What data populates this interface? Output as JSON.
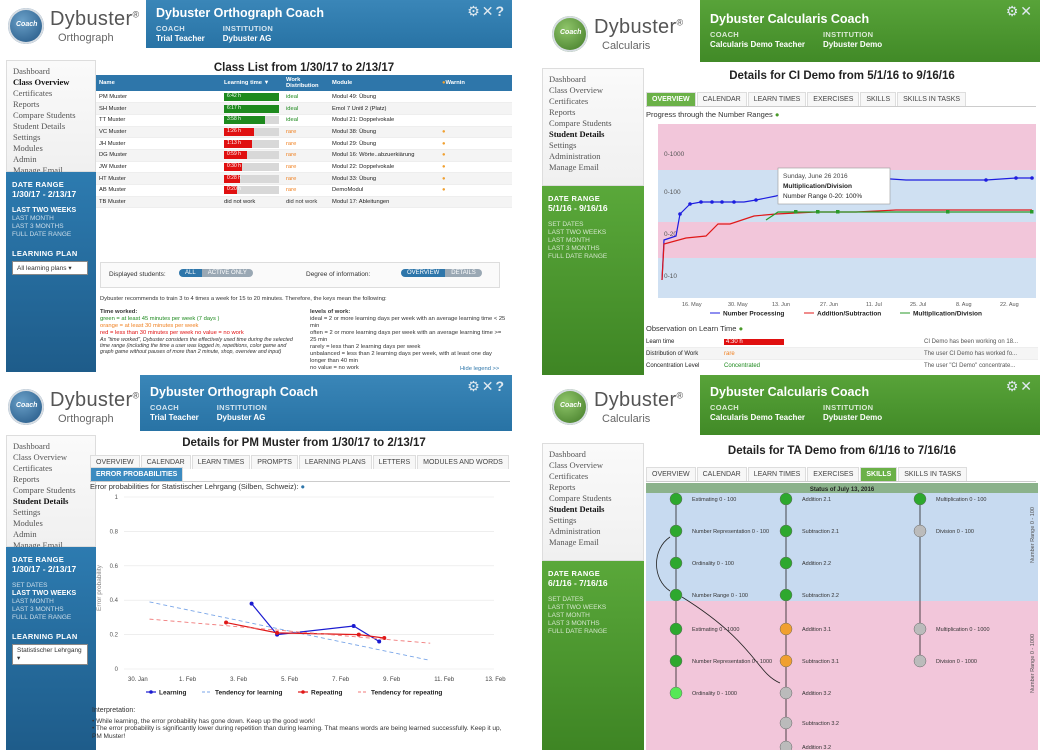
{
  "orthograph_classlist": {
    "logo": {
      "main": "Dybuster",
      "sub": "Orthograph",
      "badge": "Coach"
    },
    "band": {
      "title": "Dybuster Orthograph Coach",
      "coach_label": "COACH",
      "coach": "Trial Teacher",
      "inst_label": "INSTITUTION",
      "inst": "Dybuster AG",
      "icons": "⚙✕?"
    },
    "nav": [
      "Dashboard",
      "Class Overview",
      "Certificates",
      "Reports",
      "Compare Students",
      "Student Details",
      "Settings",
      "Modules",
      "Admin",
      "Manage Email"
    ],
    "date_range": {
      "heading": "DATE RANGE",
      "dates": "1/30/17 - 2/13/17",
      "links": [
        "LAST TWO WEEKS",
        "LAST MONTH",
        "LAST 3 MONTHS",
        "FULL DATE RANGE"
      ]
    },
    "learning_plan": {
      "heading": "LEARNING PLAN",
      "value": "All learning plans"
    },
    "title": "Class List from 1/30/17 to 2/13/17",
    "columns": [
      "Name",
      "Learning time",
      "Work Distribution",
      "Module",
      "Warnin"
    ],
    "rows": [
      {
        "name": "PM Muster",
        "time": "6:42 h",
        "pct": 1.0,
        "color": "#1e8a1e",
        "dist": "ideal",
        "module": "Modul 49: Übung",
        "warn": false
      },
      {
        "name": "SH Muster",
        "time": "6:17 h",
        "pct": 1.0,
        "color": "#1e8a1e",
        "dist": "ideal",
        "module": "Emol 7 Unitl 2 (Platz)",
        "warn": false
      },
      {
        "name": "TT Muster",
        "time": "3:58 h",
        "pct": 0.74,
        "color": "#1e8a1e",
        "dist": "ideal",
        "module": "Modul 21: Doppelvokale",
        "warn": false
      },
      {
        "name": "VC Muster",
        "time": "1:26 h",
        "pct": 0.55,
        "color": "#e01010",
        "dist": "rare",
        "module": "Modul 38: Übung",
        "warn": true
      },
      {
        "name": "JH Muster",
        "time": "1:13 h",
        "pct": 0.5,
        "color": "#e01010",
        "dist": "rare",
        "module": "Modul 29: Übung",
        "warn": true
      },
      {
        "name": "DG Muster",
        "time": "0:59 h",
        "pct": 0.42,
        "color": "#e01010",
        "dist": "rare",
        "module": "Modul 16: Wörte..abzuerkiärung",
        "warn": true
      },
      {
        "name": "JW Muster",
        "time": "0:30 h",
        "pct": 0.33,
        "color": "#e01010",
        "dist": "rare",
        "module": "Modul 22: Doppelvokale",
        "warn": true
      },
      {
        "name": "HT Muster",
        "time": "0:28 h",
        "pct": 0.29,
        "color": "#e01010",
        "dist": "rare",
        "module": "Modul 33: Übung",
        "warn": true
      },
      {
        "name": "AB Muster",
        "time": "0:20 h",
        "pct": 0.24,
        "color": "#e01010",
        "dist": "rare",
        "module": "DemoModul",
        "warn": true
      },
      {
        "name": "TB Muster",
        "time": "did not work",
        "pct": 0,
        "color": "#e01010",
        "dist": "did not work",
        "module": "Modul 17: Ableitungen",
        "warn": false
      }
    ],
    "displayed_label": "Displayed students:",
    "displayed_opts": [
      "ALL",
      "ACTIVE ONLY"
    ],
    "degree_label": "Degree of information:",
    "degree_opts": [
      "OVERVIEW",
      "DETAILS"
    ],
    "recommend": "Dybuster recommends to train 3 to 4 times a week for 15 to 20 minutes. Therefore, the keys mean the following:",
    "legend_time_h": "Time worked:",
    "legend_time": [
      "green = at least 45 minutes per week (7 days )",
      "orange = at least 30 minutes per week",
      "red = less than 30 minutes per week no value = no work",
      "As \"time worked\", Dybuster considers the effectively used time during the selected time range (including the time a user was logged in, repetitions, color game and graph game without pauses of more than 2 minute, shop, overview and input)"
    ],
    "legend_levels_h": "levels of work:",
    "legend_levels": [
      "ideal = 2 or more learning days per week with an average learning time < 25 min",
      "often = 2 or more learning days per week with an average learning time >= 25 min",
      "rarely = less than 2 learning days per week",
      "unbalanced = less than 2 learning days per week, with at least one day longer than 40 min",
      "no value = no work"
    ],
    "hide_legend": "Hide legend >>"
  },
  "calcularis_ci": {
    "logo": {
      "main": "Dybuster",
      "sub": "Calcularis",
      "badge": "Coach"
    },
    "band": {
      "title": "Dybuster Calcularis Coach",
      "coach_label": "COACH",
      "coach": "Calcularis Demo Teacher",
      "inst_label": "INSTITUTION",
      "inst": "Dybuster Demo",
      "icons": "⚙✕"
    },
    "nav": [
      "Dashboard",
      "Class Overview",
      "Certificates",
      "Reports",
      "Compare Students",
      "Student Details",
      "Settings",
      "Administration",
      "Manage Email"
    ],
    "date_range": {
      "heading": "DATE RANGE",
      "dates": "5/1/16 - 9/16/16",
      "links": [
        "SET DATES",
        "LAST TWO WEEKS",
        "LAST MONTH",
        "LAST 3 MONTHS",
        "FULL DATE RANGE"
      ]
    },
    "title": "Details for CI Demo from 5/1/16 to 9/16/16",
    "tabs": [
      "OVERVIEW",
      "CALENDAR",
      "LEARN TIMES",
      "EXERCISES",
      "SKILLS",
      "SKILLS IN TASKS"
    ],
    "progress_label": "Progress through the Number Ranges",
    "tooltip": {
      "date": "Sunday, June 26 2016",
      "series": "Multiplication/Division",
      "value": "Number Range 0-20: 100%"
    },
    "obs_label": "Observation on Learn Time",
    "obs": [
      {
        "label": "Learn time",
        "value": "4:30 h",
        "note": "CI Demo has been working on 18..."
      },
      {
        "label": "Distribution of Work",
        "value": "rare",
        "note": "The user CI Demo has worked fo..."
      },
      {
        "label": "Concentration Level",
        "value": "Concentrated",
        "note": "The user \"CI Demo\" concentrate..."
      }
    ],
    "chart_data": {
      "type": "line",
      "x": [
        "16. May",
        "30. May",
        "13. Jun",
        "27. Jun",
        "11. Jul",
        "25. Jul",
        "8. Aug",
        "22. Aug"
      ],
      "bands": [
        "0-1000",
        "0-100",
        "0-20",
        "0-10"
      ],
      "series": [
        {
          "name": "Number Processing",
          "color": "#1d1de0"
        },
        {
          "name": "Addition/Subtraction",
          "color": "#e01818"
        },
        {
          "name": "Multiplication/Division",
          "color": "#2a9a2a"
        }
      ]
    }
  },
  "orthograph_pm": {
    "logo": {
      "main": "Dybuster",
      "sub": "Orthograph",
      "badge": "Coach"
    },
    "band": {
      "title": "Dybuster Orthograph Coach",
      "coach_label": "COACH",
      "coach": "Trial Teacher",
      "inst_label": "INSTITUTION",
      "inst": "Dybuster AG",
      "icons": "⚙✕?"
    },
    "nav": [
      "Dashboard",
      "Class Overview",
      "Certificates",
      "Reports",
      "Compare Students",
      "Student Details",
      "Settings",
      "Modules",
      "Admin",
      "Manage Email"
    ],
    "date_range": {
      "heading": "DATE RANGE",
      "dates": "1/30/17 - 2/13/17",
      "links": [
        "SET DATES",
        "LAST TWO WEEKS",
        "LAST MONTH",
        "LAST 3 MONTHS",
        "FULL DATE RANGE"
      ]
    },
    "learning_plan": {
      "heading": "LEARNING PLAN",
      "value": "Statistischer Lehrgang"
    },
    "title": "Details for PM Muster from 1/30/17 to 2/13/17",
    "tabs": [
      "OVERVIEW",
      "CALENDAR",
      "LEARN TIMES",
      "PROMPTS",
      "LEARNING PLANS",
      "LETTERS",
      "MODULES AND WORDS"
    ],
    "subtab": "ERROR PROBABILITIES",
    "chart_title": "Error probabilities for Statistischer Lehrgang (Silben, Schweiz):",
    "interp_h": "Interpretation:",
    "interp": [
      "While learning, the error probability has gone down. Keep up the good work!",
      "The error probability is significantly lower during repetition than during learning. That means words are being learned successfully. Keep it up, PM Muster!"
    ],
    "chart_data": {
      "type": "line",
      "xlabels": [
        "30. Jan",
        "1. Feb",
        "3. Feb",
        "5. Feb",
        "7. Feb",
        "9. Feb",
        "11. Feb",
        "13. Feb"
      ],
      "ylabel": "Error probability",
      "ylim": [
        0,
        1
      ],
      "yticks": [
        "0",
        "0.2",
        "0.4",
        "0.6",
        "0.8",
        "1"
      ],
      "series": [
        {
          "name": "Learning",
          "color": "#1a1ad0",
          "points": [
            [
              5,
              0.38
            ],
            [
              6,
              0.2
            ],
            [
              9,
              0.25
            ],
            [
              10,
              0.16
            ]
          ]
        },
        {
          "name": "Tendency for learning",
          "color": "#7aa6e8",
          "points": [
            [
              1,
              0.39
            ],
            [
              12,
              0.05
            ]
          ]
        },
        {
          "name": "Repeating",
          "color": "#e01818",
          "points": [
            [
              4,
              0.27
            ],
            [
              6,
              0.21
            ],
            [
              9.2,
              0.2
            ],
            [
              10.2,
              0.18
            ]
          ]
        },
        {
          "name": "Tendency for repeating",
          "color": "#f07a7a",
          "points": [
            [
              1,
              0.29
            ],
            [
              12,
              0.15
            ]
          ]
        }
      ]
    }
  },
  "calcularis_ta": {
    "logo": {
      "main": "Dybuster",
      "sub": "Calcularis",
      "badge": "Coach"
    },
    "band": {
      "title": "Dybuster Calcularis Coach",
      "coach_label": "COACH",
      "coach": "Calcularis Demo Teacher",
      "inst_label": "INSTITUTION",
      "inst": "Dybuster Demo",
      "icons": "⚙✕"
    },
    "nav": [
      "Dashboard",
      "Class Overview",
      "Certificates",
      "Reports",
      "Compare Students",
      "Student Details",
      "Settings",
      "Administration",
      "Manage Email"
    ],
    "date_range": {
      "heading": "DATE RANGE",
      "dates": "6/1/16 - 7/16/16",
      "links": [
        "SET DATES",
        "LAST TWO WEEKS",
        "LAST MONTH",
        "LAST 3 MONTHS",
        "FULL DATE RANGE"
      ]
    },
    "title": "Details for TA Demo from 6/1/16 to 7/16/16",
    "tabs": [
      "OVERVIEW",
      "CALENDAR",
      "LEARN TIMES",
      "EXERCISES",
      "SKILLS",
      "SKILLS IN TASKS"
    ],
    "status": "Status of July 13, 2016",
    "band100": "Number Range 0 - 100",
    "band1000": "Number Range 0 - 1000",
    "col1": [
      {
        "t": "Estimating 0 - 100",
        "c": "#2ea82e"
      },
      {
        "t": "Number Representation 0 - 100",
        "c": "#2ea82e"
      },
      {
        "t": "Ordinality 0 - 100",
        "c": "#2ea82e"
      },
      {
        "t": "Number Range 0 - 100",
        "c": "#2ea82e"
      },
      {
        "t": "Estimating 0 - 1000",
        "c": "#2ea82e"
      },
      {
        "t": "Number Representation 0 - 1000",
        "c": "#2ea82e"
      },
      {
        "t": "Ordinality 0 - 1000",
        "c": "#56e856"
      }
    ],
    "col2": [
      {
        "t": "Addition 2.1",
        "c": "#2ea82e"
      },
      {
        "t": "Subtraction 2.1",
        "c": "#2ea82e"
      },
      {
        "t": "Addition 2.2",
        "c": "#2ea82e"
      },
      {
        "t": "Subtraction 2.2",
        "c": "#2ea82e"
      },
      {
        "t": "Addition 3.1",
        "c": "#f0a030"
      },
      {
        "t": "Subtraction 3.1",
        "c": "#f0a030"
      },
      {
        "t": "Addition 3.2",
        "c": "#bbbbbb"
      },
      {
        "t": "Subtraction 3.2",
        "c": "#bbbbbb"
      },
      {
        "t": "Addition 3.2",
        "c": "#bbbbbb"
      }
    ],
    "col3": [
      {
        "t": "Multiplication 0 - 100",
        "c": "#2ea82e"
      },
      {
        "t": "Division 0 - 100",
        "c": "#bbbbbb"
      },
      {
        "t": "Multiplication 0 - 1000",
        "c": "#bbbbbb"
      },
      {
        "t": "Division 0 - 1000",
        "c": "#bbbbbb"
      }
    ]
  }
}
